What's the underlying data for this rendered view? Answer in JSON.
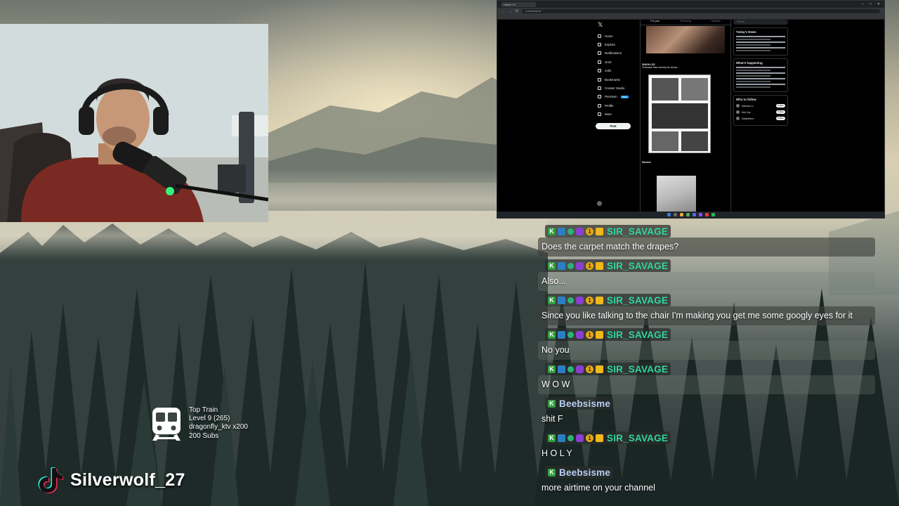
{
  "browser": {
    "tab_title": "Home / X",
    "url": "x.com/home",
    "x_nav": [
      "Home",
      "Explore",
      "Notifications",
      "Grok",
      "Jobs",
      "Bookmarks",
      "Creator Studio",
      "Premium",
      "Profile",
      "More"
    ],
    "x_premium_badge": "NEW",
    "x_post_button": "Post",
    "x_feed_tabs": [
      "For you",
      "Following",
      "Valhalla"
    ],
    "x_tweet1_author": "SIMON LEE",
    "x_tweet1_text": "Chainsaw Man reaches its climax...",
    "x_tweet2_author": "Manami",
    "x_right": {
      "search_placeholder": "Search",
      "news_title": "Today's News",
      "happening_title": "What's happening",
      "follow_title": "Who to follow",
      "follow_button": "Follow",
      "follow_names": [
        "Manhwa Lu",
        "Nick Xay",
        "DailyMemes"
      ]
    }
  },
  "chat": [
    {
      "username": "SIR_SAVAGE",
      "name_color": "#2fd6a0",
      "badges": [
        "k",
        "x",
        "v",
        "c",
        "1",
        "m"
      ],
      "text": "Does the carpet match the drapes?"
    },
    {
      "username": "SIR_SAVAGE",
      "name_color": "#2fd6a0",
      "badges": [
        "k",
        "x",
        "v",
        "c",
        "1",
        "m"
      ],
      "text": "Also..."
    },
    {
      "username": "SIR_SAVAGE",
      "name_color": "#2fd6a0",
      "badges": [
        "k",
        "x",
        "v",
        "c",
        "1",
        "m"
      ],
      "text": "Since you like talking to the chair I'm making you get me some googly eyes for it"
    },
    {
      "username": "SIR_SAVAGE",
      "name_color": "#2fd6a0",
      "badges": [
        "k",
        "x",
        "v",
        "c",
        "1",
        "m"
      ],
      "text": "No you"
    },
    {
      "username": "SIR_SAVAGE",
      "name_color": "#2fd6a0",
      "badges": [
        "k",
        "x",
        "v",
        "c",
        "1",
        "m"
      ],
      "text": "W O W"
    },
    {
      "username": "Beebsisme",
      "name_color": "#b8cdf5",
      "badges": [
        "k"
      ],
      "text": "shit F"
    },
    {
      "username": "SIR_SAVAGE",
      "name_color": "#2fd6a0",
      "badges": [
        "k",
        "x",
        "v",
        "c",
        "1",
        "m"
      ],
      "text": "H O L Y"
    },
    {
      "username": "Beebsisme",
      "name_color": "#b8cdf5",
      "badges": [
        "k"
      ],
      "text": "more airtime on your channel"
    }
  ],
  "train": {
    "title": "Top Train",
    "level": "Level 9  (265)",
    "top_gifter": "dragonfly_ktv x200",
    "subs": "200 Subs",
    "icon": "train-icon"
  },
  "tiktok": {
    "handle": "Silverwolf_27",
    "icon": "tiktok-logo-icon"
  },
  "colors": {
    "savage": "#2fd6a0",
    "beebsisme": "#b8cdf5",
    "x_blue": "#1d9bf0"
  }
}
